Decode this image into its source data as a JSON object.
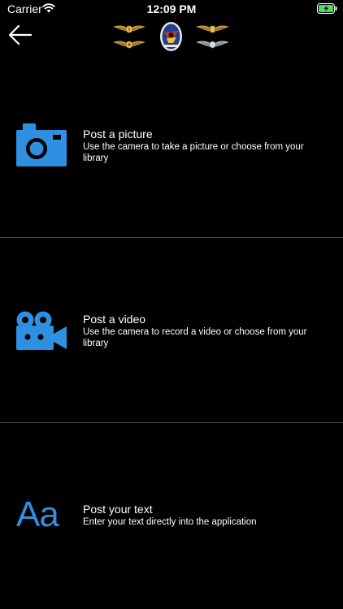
{
  "status_bar": {
    "carrier": "Carrier",
    "time": "12:09 PM",
    "battery_color": "#4cd964"
  },
  "nav": {
    "back_icon": "arrow-left-icon"
  },
  "header_badges": [
    {
      "name": "gold-wings-badge-left-top"
    },
    {
      "name": "gold-wings-badge-left-bottom"
    },
    {
      "name": "squadron-patch-badge"
    },
    {
      "name": "gold-wings-badge-right-top"
    },
    {
      "name": "silver-wings-badge-right-bottom"
    }
  ],
  "options": [
    {
      "icon": "camera-icon",
      "title": "Post a picture",
      "description": "Use the camera to take a picture or choose from your library"
    },
    {
      "icon": "video-camera-icon",
      "title": "Post a video",
      "description": "Use the camera to record a video or choose from your library"
    },
    {
      "icon": "text-icon",
      "icon_text": "Aa",
      "title": "Post your text",
      "description": "Enter your text directly into the application"
    }
  ],
  "colors": {
    "accent": "#2f8fe0",
    "background": "#000000",
    "divider": "#4a4a4a"
  }
}
